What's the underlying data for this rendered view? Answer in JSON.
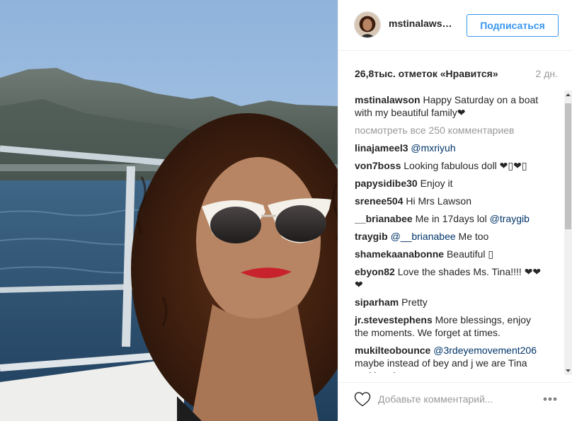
{
  "post": {
    "photo_name": "boat-selfie-photo"
  },
  "header": {
    "username": "mstinalaws…",
    "follow_label": "Подписаться"
  },
  "meta": {
    "likes": "26,8тыс. отметок «Нравится»",
    "time_ago": "2 дн."
  },
  "caption": {
    "user": "mstinalawson",
    "text": "Happy Saturday on a boat with my beautiful family❤"
  },
  "load_more": "посмотреть все 250 комментариев",
  "comments": [
    {
      "user": "linajameel3",
      "mention": "@mxriyuh",
      "text": ""
    },
    {
      "user": "von7boss",
      "mention": "",
      "text": "Looking fabulous doll ❤▯❤▯"
    },
    {
      "user": "papysidibe30",
      "mention": "",
      "text": "Enjoy it"
    },
    {
      "user": "srenee504",
      "mention": "",
      "text": "Hi Mrs Lawson"
    },
    {
      "user": "__brianabee",
      "mention": "",
      "text": "Me in 17days lol",
      "mention_after": "@traygib"
    },
    {
      "user": "traygib",
      "mention": "@__brianabee",
      "text": "Me too"
    },
    {
      "user": "shamekaanabonne",
      "mention": "",
      "text": "Beautiful ▯"
    },
    {
      "user": "ebyon82",
      "mention": "",
      "text": "Love the shades Ms. Tina!!!! ❤❤❤"
    },
    {
      "user": "siparham",
      "mention": "",
      "text": "Pretty"
    },
    {
      "user": "jr.stevestephens",
      "mention": "",
      "text": "More blessings, enjoy the moments. We forget at times."
    },
    {
      "user": "mukilteobounce",
      "mention": "@3rdeyemovement206",
      "text": "maybe instead of bey and j we are Tina and bae bae"
    }
  ],
  "footer": {
    "comment_placeholder": "Добавьте комментарий..."
  },
  "icons": {
    "like": "heart-icon",
    "more": "more-options-icon",
    "scroll_up": "scroll-up-arrow-icon",
    "scroll_down": "scroll-down-arrow-icon"
  },
  "colors": {
    "accent": "#3897f0",
    "text": "#262626",
    "muted": "#999999",
    "mention": "#003569",
    "border": "#efefef"
  }
}
